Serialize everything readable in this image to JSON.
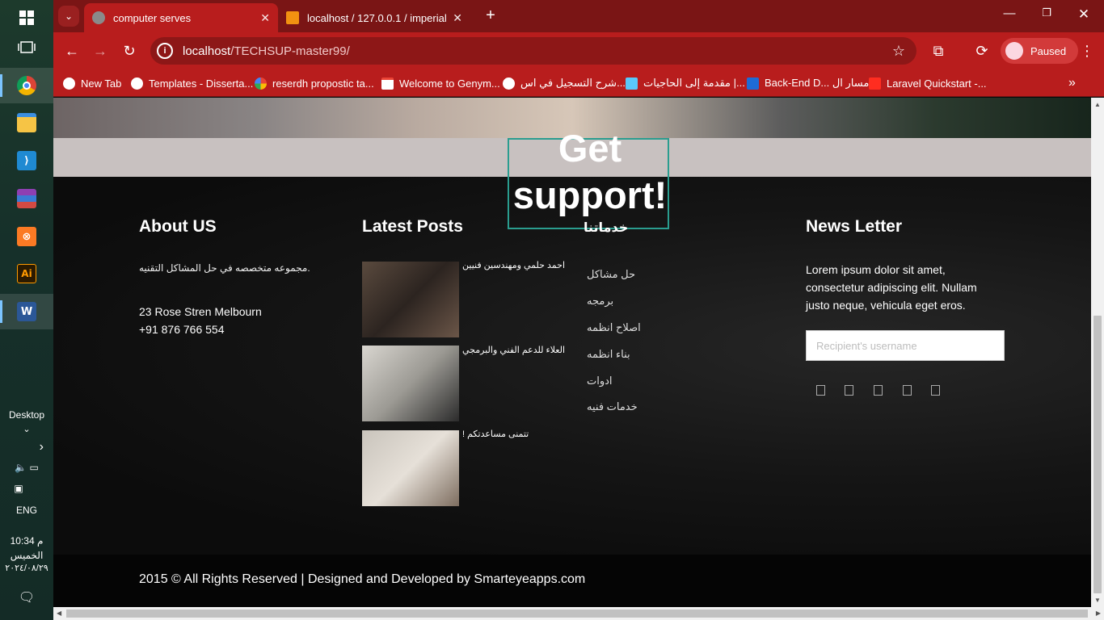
{
  "taskbar": {
    "apps": [
      {
        "icon": "windows-start-icon"
      },
      {
        "icon": "task-view-icon"
      },
      {
        "icon": "chrome-icon"
      },
      {
        "icon": "file-explorer-icon"
      },
      {
        "icon": "vscode-icon"
      },
      {
        "icon": "winrar-icon"
      },
      {
        "icon": "xampp-icon"
      },
      {
        "icon": "illustrator-icon",
        "label": "Ai"
      },
      {
        "icon": "word-icon",
        "label": "W"
      }
    ],
    "desktop_label": "Desktop",
    "language": "ENG",
    "time": "10:34 م",
    "day": "الخميس",
    "date": "٢٠٢٤/٠٨/٢٩"
  },
  "browser": {
    "tabs": [
      {
        "title": "computer serves",
        "active": true
      },
      {
        "title": "localhost / 127.0.0.1 / imperial_",
        "active": false
      }
    ],
    "address": {
      "host": "localhost",
      "path": "/TECHSUP-master99/"
    },
    "profile_status": "Paused",
    "bookmarks": [
      {
        "label": "New Tab",
        "icon": "globe-icon"
      },
      {
        "label": "Templates - Disserta...",
        "icon": "globe-icon"
      },
      {
        "label": "reserdh propostic ta...",
        "icon": "google-icon"
      },
      {
        "label": "Welcome to Genym...",
        "icon": "gmail-icon"
      },
      {
        "label": "شرح التسجيل في اس...",
        "icon": "globe-icon"
      },
      {
        "label": "مقدمة إلى الحاجيات |...",
        "icon": "flutter-icon"
      },
      {
        "label": "Back-End D... مسار ال",
        "icon": "e-icon"
      },
      {
        "label": "Laravel Quickstart -...",
        "icon": "laravel-icon"
      }
    ]
  },
  "page": {
    "support_title": "Get support!",
    "about": {
      "title": "About US",
      "description": "مجموعه متخصصه في حل المشاكل التقنيه.",
      "address": "23 Rose Stren Melbourn",
      "phone": "+91 876 766 554"
    },
    "posts": {
      "title": "Latest Posts",
      "items": [
        {
          "title": "احمد حلمي ومهندسين فنيين"
        },
        {
          "title": "العلاء للدعم الفني والبرمجي"
        },
        {
          "title": "تتمنى مساعدتكم !"
        }
      ]
    },
    "services": {
      "title": "خدماتنا",
      "items": [
        "حل مشاكل",
        "برمجه",
        "اصلاح انظمه",
        "بناء انظمه",
        "ادوات",
        "خدمات فنيه"
      ]
    },
    "newsletter": {
      "title": "News Letter",
      "text": "Lorem ipsum dolor sit amet, consectetur adipiscing elit. Nullam justo neque, vehicula eget eros.",
      "placeholder": "Recipient's username"
    },
    "copyright": "2015 © All Rights Reserved | Designed and Developed by Smarteyeapps.com"
  }
}
